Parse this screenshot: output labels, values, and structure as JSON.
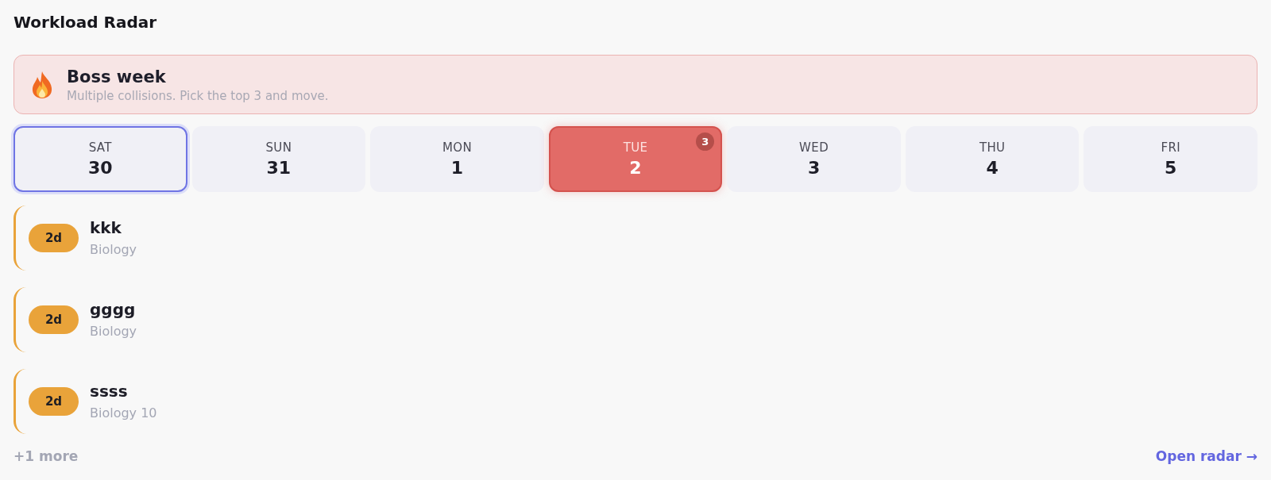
{
  "title": "Workload Radar",
  "alert": {
    "title": "Boss week",
    "message": "Multiple collisions. Pick the top 3 and move."
  },
  "days": [
    {
      "weekday": "SAT",
      "date": "30",
      "selected": true,
      "overloaded": false
    },
    {
      "weekday": "SUN",
      "date": "31",
      "selected": false,
      "overloaded": false
    },
    {
      "weekday": "MON",
      "date": "1",
      "selected": false,
      "overloaded": false
    },
    {
      "weekday": "TUE",
      "date": "2",
      "selected": false,
      "overloaded": true,
      "count": "3"
    },
    {
      "weekday": "WED",
      "date": "3",
      "selected": false,
      "overloaded": false
    },
    {
      "weekday": "THU",
      "date": "4",
      "selected": false,
      "overloaded": false
    },
    {
      "weekday": "FRI",
      "date": "5",
      "selected": false,
      "overloaded": false
    }
  ],
  "tasks": [
    {
      "due": "2d",
      "title": "kkk",
      "subject": "Biology"
    },
    {
      "due": "2d",
      "title": "gggg",
      "subject": "Biology"
    },
    {
      "due": "2d",
      "title": "ssss",
      "subject": "Biology 10"
    }
  ],
  "footer": {
    "more": "+1 more",
    "link": "Open radar →"
  }
}
